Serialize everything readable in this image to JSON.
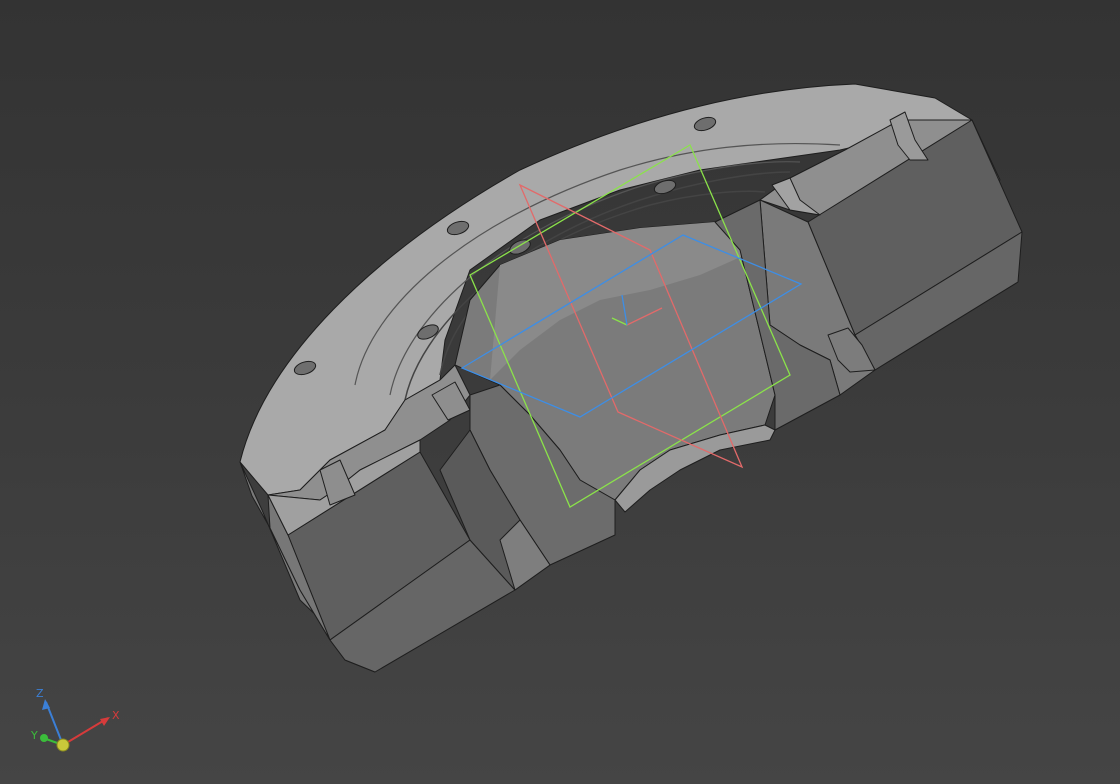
{
  "viewport": {
    "background": "#3c3c3c",
    "model_colors": {
      "face_light": "#a8a8a8",
      "face_mid": "#8a8a8a",
      "face_dark": "#6a6a6a",
      "face_darker": "#5c5c5c",
      "edge": "#1e1e1e"
    },
    "datum_planes": {
      "xy_plane_color": "#3d8ee6",
      "xz_plane_color": "#e26a6a",
      "yz_plane_color": "#8be34a"
    }
  },
  "nav_cube_axes": {
    "x": {
      "label": "X",
      "color": "#d63b3b"
    },
    "y": {
      "label": "Y",
      "color": "#3bbd3b"
    },
    "z": {
      "label": "Z",
      "color": "#3b7fd6"
    },
    "origin_color": "#c9c93a"
  }
}
